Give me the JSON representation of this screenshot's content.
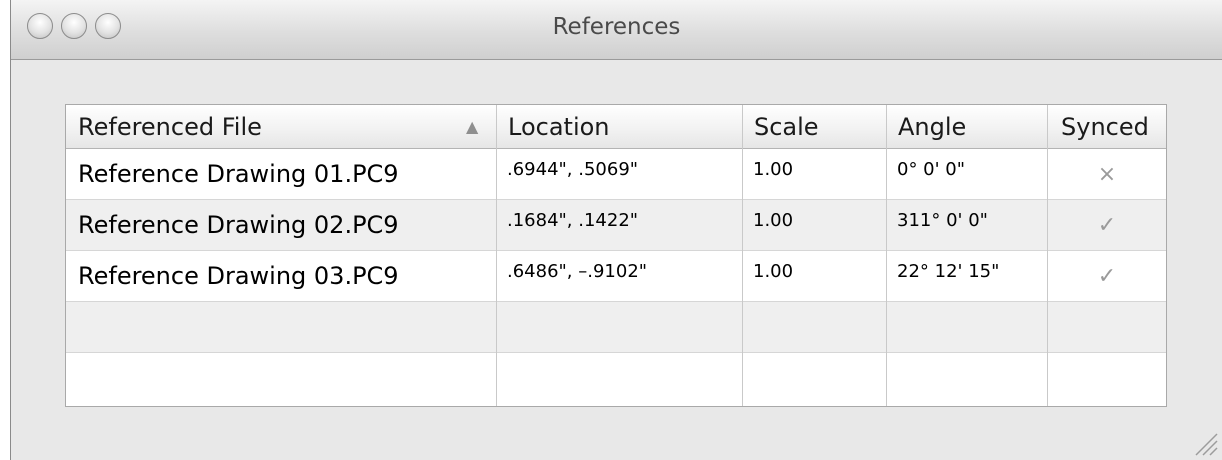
{
  "window": {
    "title": "References"
  },
  "table": {
    "columns": [
      {
        "label": "Referenced File"
      },
      {
        "label": "Location"
      },
      {
        "label": "Scale"
      },
      {
        "label": "Angle"
      },
      {
        "label": "Synced"
      }
    ],
    "sort_indicator": "▲",
    "rows": [
      {
        "file": "Reference Drawing 01.PC9",
        "location": ".6944\", .5069\"",
        "scale": "1.00",
        "angle": "0° 0' 0\"",
        "synced": "×"
      },
      {
        "file": "Reference Drawing 02.PC9",
        "location": ".1684\", .1422\"",
        "scale": "1.00",
        "angle": "311° 0' 0\"",
        "synced": "✓"
      },
      {
        "file": "Reference Drawing 03.PC9",
        "location": ".6486\", –.9102\"",
        "scale": "1.00",
        "angle": "22° 12' 15\"",
        "synced": "✓"
      }
    ]
  },
  "icons": {
    "close": "close-button-icon",
    "minimize": "minimize-button-icon",
    "zoom": "zoom-button-icon",
    "sort": "sort-ascending-icon",
    "resize": "resize-grip-icon"
  }
}
